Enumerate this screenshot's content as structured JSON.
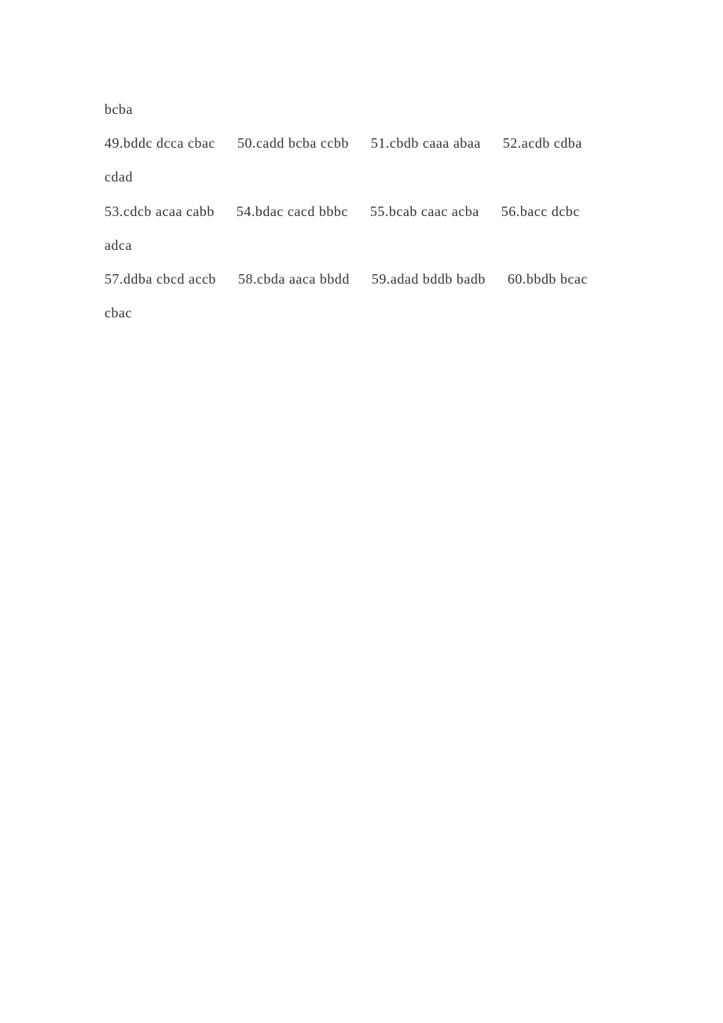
{
  "lines": [
    {
      "type": "plain",
      "text": "bcba"
    },
    {
      "type": "row",
      "items": [
        {
          "n": "49",
          "t": "bddc dcca cbac"
        },
        {
          "n": "50",
          "t": "cadd bcba ccbb"
        },
        {
          "n": "51",
          "t": "cbdb caaa abaa"
        },
        {
          "n": "52",
          "t": "acdb cdba"
        }
      ]
    },
    {
      "type": "plain",
      "text": "cdad"
    },
    {
      "type": "row",
      "items": [
        {
          "n": "53",
          "t": "cdcb acaa cabb"
        },
        {
          "n": "54",
          "t": "bdac cacd bbbc"
        },
        {
          "n": "55",
          "t": "bcab caac acba"
        },
        {
          "n": "56",
          "t": "bacc dcbc"
        }
      ]
    },
    {
      "type": "plain",
      "text": "adca"
    },
    {
      "type": "row",
      "items": [
        {
          "n": "57",
          "t": "ddba cbcd accb"
        },
        {
          "n": "58",
          "t": "cbda aaca bbdd"
        },
        {
          "n": "59",
          "t": "adad bddb badb"
        },
        {
          "n": "60",
          "t": "bbdb bcac"
        }
      ]
    },
    {
      "type": "plain",
      "text": "cbac"
    }
  ]
}
